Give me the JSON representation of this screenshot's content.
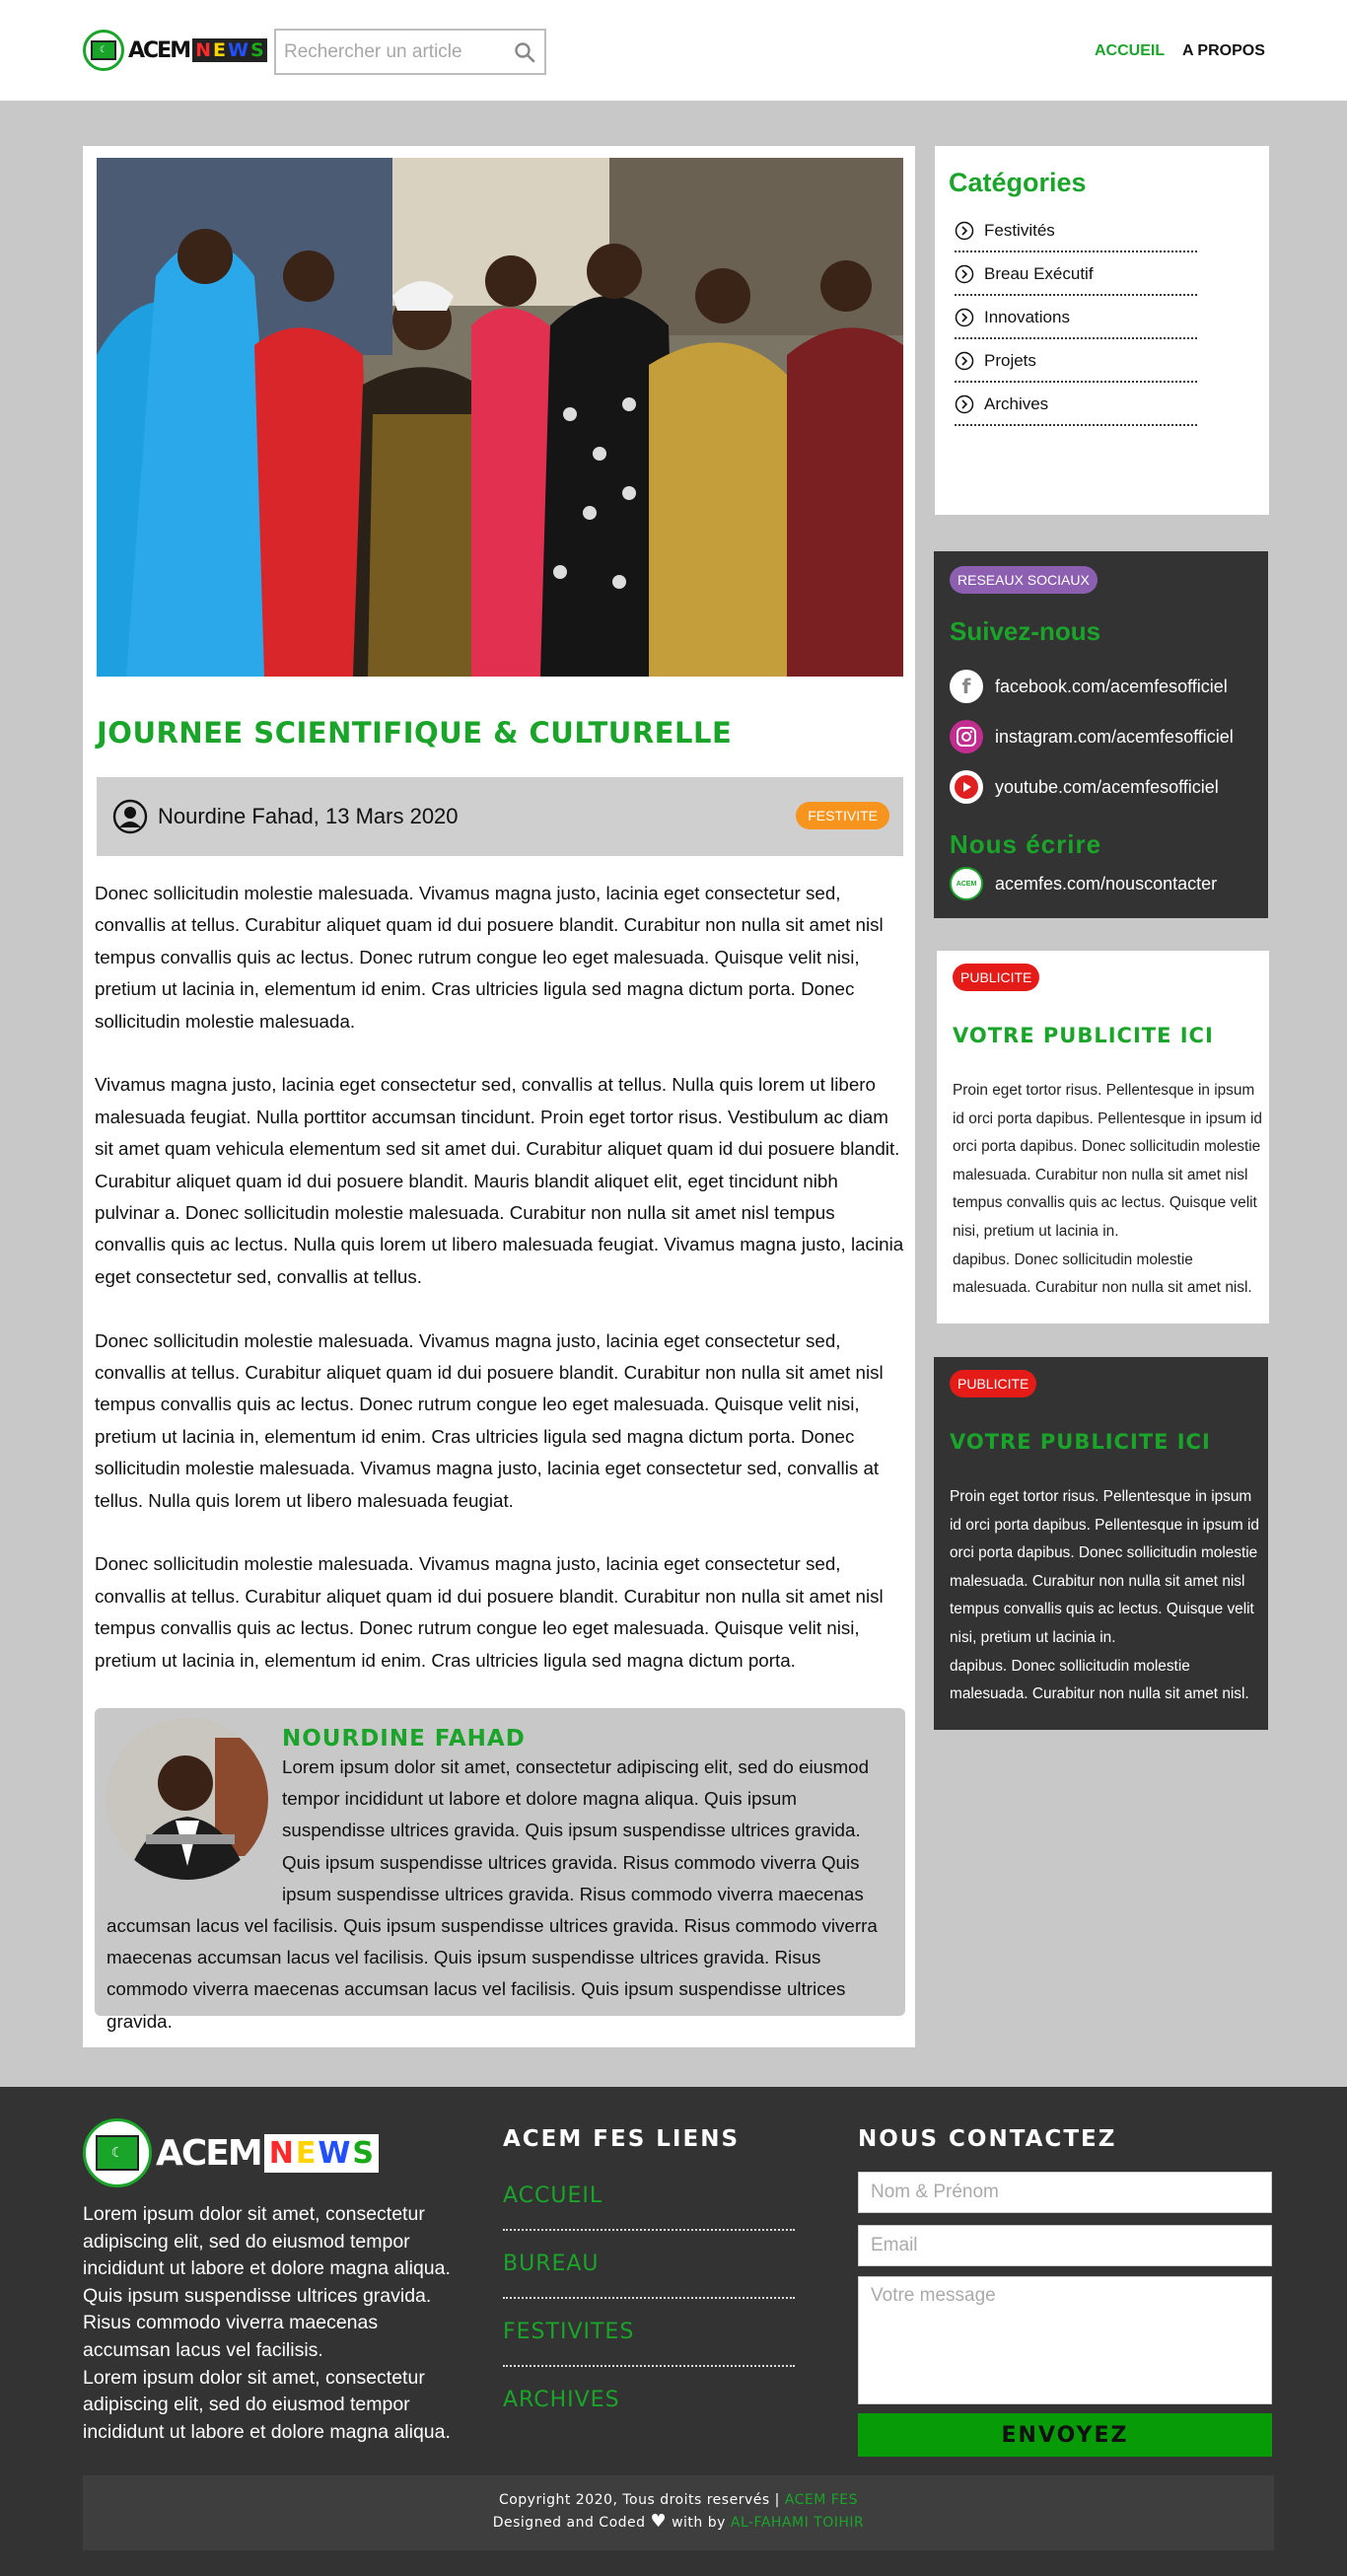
{
  "header": {
    "logo": {
      "acem": "ACEM",
      "news_letters": [
        "N",
        "E",
        "W",
        "S"
      ],
      "news_colors": [
        "#ff2b2b",
        "#ffd400",
        "#2250ff",
        "#18a818"
      ]
    },
    "search": {
      "placeholder": "Rechercher un article",
      "icon": "search-icon"
    },
    "nav": {
      "home": "ACCUEIL",
      "about": "A PROPOS"
    }
  },
  "article": {
    "title": "JOURNEE SCIENTIFIQUE & CULTURELLE",
    "byline": "Nourdine Fahad, 13 Mars 2020",
    "tag": "FESTIVITE",
    "paragraphs": [
      "Donec sollicitudin molestie malesuada. Vivamus magna justo, lacinia eget consectetur sed, convallis at tellus. Curabitur aliquet quam id dui posuere blandit. Curabitur non nulla sit amet nisl tempus convallis quis ac lectus. Donec rutrum congue leo eget malesuada. Quisque velit nisi, pretium ut lacinia in, elementum id enim. Cras ultricies ligula sed magna dictum porta. Donec sollicitudin molestie malesuada.",
      "Vivamus magna justo, lacinia eget consectetur sed, convallis at tellus. Nulla quis lorem ut libero malesuada feugiat. Nulla porttitor accumsan tincidunt. Proin eget tortor risus. Vestibulum ac diam sit amet quam vehicula elementum sed sit amet dui. Curabitur aliquet quam id dui posuere blandit. Curabitur aliquet quam id dui posuere blandit. Mauris blandit aliquet elit, eget tincidunt nibh pulvinar a. Donec sollicitudin molestie malesuada. Curabitur non nulla sit amet nisl tempus convallis quis ac lectus. Nulla quis lorem ut libero malesuada feugiat. Vivamus magna justo, lacinia eget consectetur sed, convallis at tellus.",
      "Donec sollicitudin molestie malesuada. Vivamus magna justo, lacinia eget consectetur sed, convallis at tellus. Curabitur aliquet quam id dui posuere blandit. Curabitur non nulla sit amet nisl tempus convallis quis ac lectus. Donec rutrum congue leo eget malesuada. Quisque velit nisi, pretium ut lacinia in, elementum id enim. Cras ultricies ligula sed magna dictum porta. Donec sollicitudin molestie malesuada. Vivamus magna justo, lacinia eget consectetur sed, convallis at tellus. Nulla quis lorem ut libero malesuada feugiat.",
      "Donec sollicitudin molestie malesuada. Vivamus magna justo, lacinia eget consectetur sed, convallis at tellus. Curabitur aliquet quam id dui posuere blandit. Curabitur non nulla sit amet nisl tempus convallis quis ac lectus. Donec rutrum congue leo eget malesuada. Quisque velit nisi, pretium ut lacinia in, elementum id enim. Cras ultricies ligula sed magna dictum porta."
    ],
    "author_bio": {
      "name": "NOURDINE FAHAD",
      "text": "Lorem ipsum dolor sit amet, consectetur adipiscing elit, sed do eiusmod tempor incididunt ut labore et dolore magna aliqua. Quis ipsum suspendisse ultrices gravida.  Quis ipsum suspendisse ultrices gravida. Quis ipsum suspendisse ultrices gravida. Risus commodo viverra Quis ipsum suspendisse ultrices gravida. Risus commodo viverra maecenas accumsan lacus vel facilisis.  Quis ipsum suspendisse ultrices gravida. Risus commodo viverra maecenas accumsan lacus vel facilisis.  Quis ipsum suspendisse ultrices gravida. Risus commodo viverra maecenas accumsan lacus vel facilisis.  Quis ipsum suspendisse ultrices gravida."
    }
  },
  "sidebar": {
    "categories": {
      "title": "Catégories",
      "items": [
        "Festivités",
        "Breau Exécutif",
        "Innovations",
        "Projets",
        "Archives"
      ]
    },
    "social": {
      "badge": "RESEAUX SOCIAUX",
      "title": "Suivez-nous",
      "links": [
        {
          "icon": "facebook-icon",
          "label": "facebook.com/acemfesofficiel"
        },
        {
          "icon": "instagram-icon",
          "label": "instagram.com/acemfesofficiel"
        },
        {
          "icon": "youtube-icon",
          "label": "youtube.com/acemfesofficiel"
        }
      ],
      "contact_title": "Nous écrire",
      "contact_label": "acemfes.com/nouscontacter",
      "contact_emblem": "ACEM"
    },
    "ads": [
      {
        "badge": "PUBLICITE",
        "title": "VOTRE PUBLICITE ICI",
        "lines": [
          "Proin eget tortor risus. Pellentesque in ipsum",
          "id orci porta dapibus. Pellentesque in ipsum id",
          "orci porta dapibus. Donec sollicitudin molestie",
          "malesuada. Curabitur non nulla sit amet nisl",
          "tempus convallis quis ac lectus. Quisque velit",
          "nisi, pretium ut lacinia in.",
          "dapibus. Donec sollicitudin molestie",
          "malesuada. Curabitur non nulla sit amet nisl."
        ]
      },
      {
        "badge": "PUBLICITE",
        "title": "VOTRE PUBLICITE ICI",
        "lines": [
          "Proin eget tortor risus. Pellentesque in ipsum",
          "id orci porta dapibus. Pellentesque in ipsum id",
          "orci porta dapibus. Donec sollicitudin molestie",
          "malesuada. Curabitur non nulla sit amet nisl",
          "tempus convallis quis ac lectus. Quisque velit",
          "nisi, pretium ut lacinia in.",
          "dapibus. Donec sollicitudin molestie",
          "malesuada. Curabitur non nulla sit amet nisl."
        ]
      }
    ]
  },
  "footer": {
    "about_lines": [
      "Lorem ipsum dolor sit amet, consectetur",
      "adipiscing elit, sed do eiusmod tempor",
      "incididunt ut labore et dolore magna aliqua.",
      "Quis ipsum suspendisse ultrices gravida.",
      "Risus commodo viverra maecenas",
      "accumsan lacus vel facilisis.",
      "Lorem ipsum dolor sit amet, consectetur",
      "adipiscing elit, sed do eiusmod tempor",
      "incididunt ut labore et dolore magna aliqua."
    ],
    "links_title": "ACEM FES LIENS",
    "links": [
      "ACCUEIL",
      "BUREAU",
      "FESTIVITES",
      "ARCHIVES"
    ],
    "contact_title": "NOUS CONTACTEZ",
    "form": {
      "name_placeholder": "Nom & Prénom",
      "email_placeholder": "Email",
      "message_placeholder": "Votre message",
      "submit": "ENVOYEZ"
    },
    "copyright": {
      "prefix": "Copyright 2020, Tous droits reservés | ",
      "brand": "ACEM FES",
      "line2_a": "Designed and Coded ",
      "line2_b": " with by ",
      "author": "AL-FAHAMI TOIHIR"
    }
  },
  "colors": {
    "brand_green": "#1aa52a",
    "tag_orange": "#f7941d",
    "pub_red": "#e41b17",
    "social_purple": "#8d5fb0",
    "dark": "#333333"
  }
}
